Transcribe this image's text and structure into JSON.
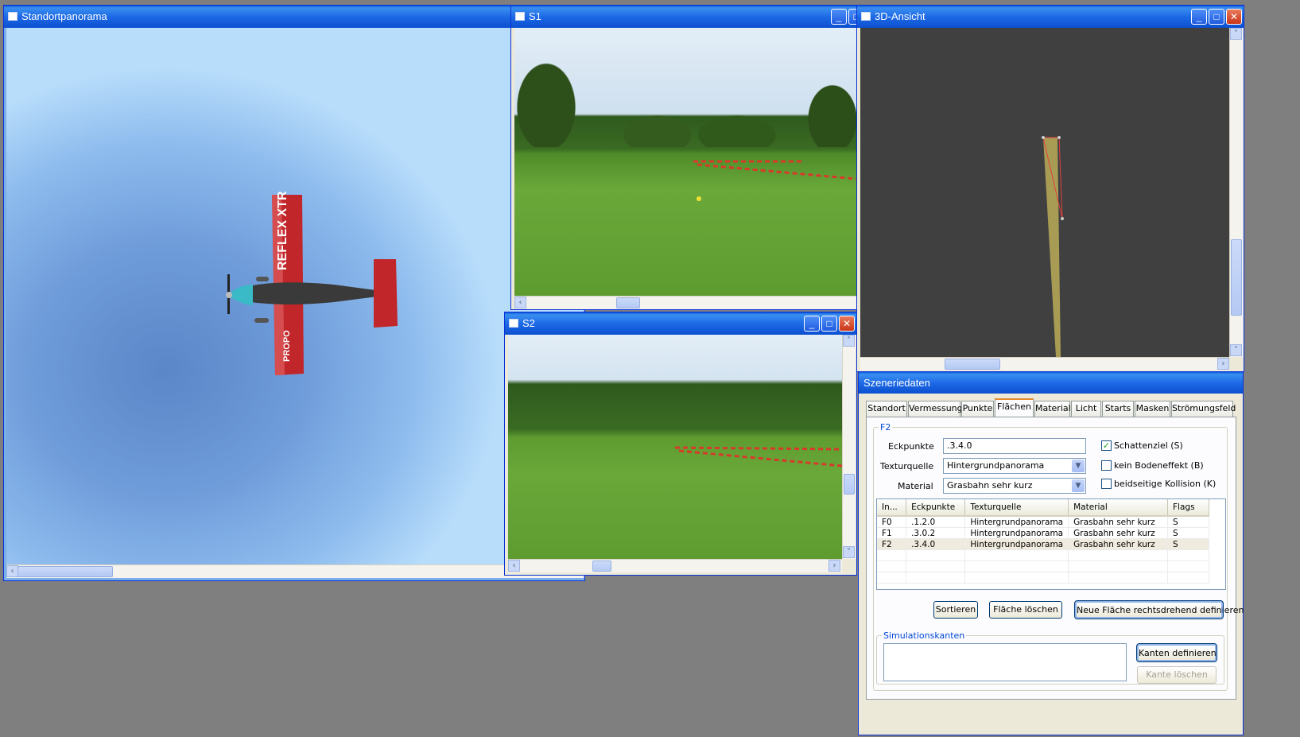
{
  "windows": {
    "panorama": {
      "title": "Standortpanorama"
    },
    "s1": {
      "title": "S1"
    },
    "s2": {
      "title": "S2"
    },
    "view3d": {
      "title": "3D-Ansicht"
    }
  },
  "aircraft": {
    "wing_text": "REFLEX XTR",
    "fuselage_text": "PROPO"
  },
  "scenery": {
    "title": "Szeneriedaten",
    "tabs": [
      "Standort",
      "Vermessung",
      "Punkte",
      "Flächen",
      "Material",
      "Licht",
      "Starts",
      "Masken",
      "Strömungsfeld"
    ],
    "active_tab": "Flächen",
    "group_label": "F2",
    "fields": {
      "eckpunkte_label": "Eckpunkte",
      "eckpunkte_value": ".3.4.0",
      "texturquelle_label": "Texturquelle",
      "texturquelle_value": "Hintergrundpanorama",
      "material_label": "Material",
      "material_value": "Grasbahn sehr kurz"
    },
    "checkboxes": [
      {
        "label": "Schattenziel (S)",
        "checked": true
      },
      {
        "label": "kein Bodeneffekt (B)",
        "checked": false
      },
      {
        "label": "beidseitige Kollision (K)",
        "checked": false
      }
    ],
    "table": {
      "headers": [
        "In...",
        "Eckpunkte",
        "Texturquelle",
        "Material",
        "Flags"
      ],
      "rows": [
        [
          "F0",
          ".1.2.0",
          "Hintergrundpanorama",
          "Grasbahn sehr kurz",
          "S"
        ],
        [
          "F1",
          ".3.0.2",
          "Hintergrundpanorama",
          "Grasbahn sehr kurz",
          "S"
        ],
        [
          "F2",
          ".3.4.0",
          "Hintergrundpanorama",
          "Grasbahn sehr kurz",
          "S"
        ]
      ],
      "selected_row": 2
    },
    "buttons": {
      "sort": "Sortieren",
      "delete_face": "Fläche löschen",
      "new_face": "Neue Fläche rechtsdrehend definieren"
    },
    "sim_edges": {
      "label": "Simulationskanten",
      "define": "Kanten definieren",
      "delete": "Kante löschen"
    }
  },
  "colors": {
    "titlebar": "#1e6ae6",
    "sky": "#7aaee8",
    "grass": "#5a9a2c",
    "view3d_bg": "#404040",
    "surface": "#a89c55"
  }
}
